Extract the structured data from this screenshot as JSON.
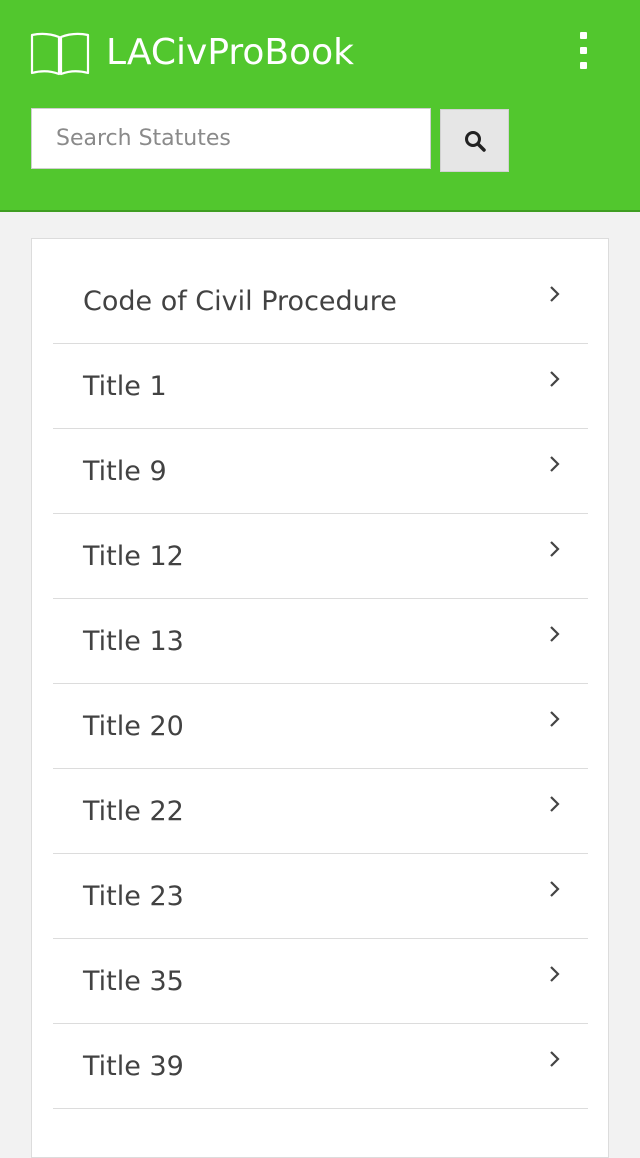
{
  "header": {
    "app_title": "LACivProBook",
    "book_icon": "open-book-icon",
    "menu_icon": "kebab-menu-icon",
    "background_color": "#52c72e"
  },
  "search": {
    "placeholder": "Search Statutes",
    "value": "",
    "button_icon": "search-icon"
  },
  "list": {
    "items": [
      {
        "label": "Code of Civil Procedure"
      },
      {
        "label": "Title 1"
      },
      {
        "label": "Title 9"
      },
      {
        "label": "Title 12"
      },
      {
        "label": "Title 13"
      },
      {
        "label": "Title 20"
      },
      {
        "label": "Title 22"
      },
      {
        "label": "Title 23"
      },
      {
        "label": "Title 35"
      },
      {
        "label": "Title 39"
      }
    ],
    "chevron_icon": "chevron-right-icon"
  }
}
